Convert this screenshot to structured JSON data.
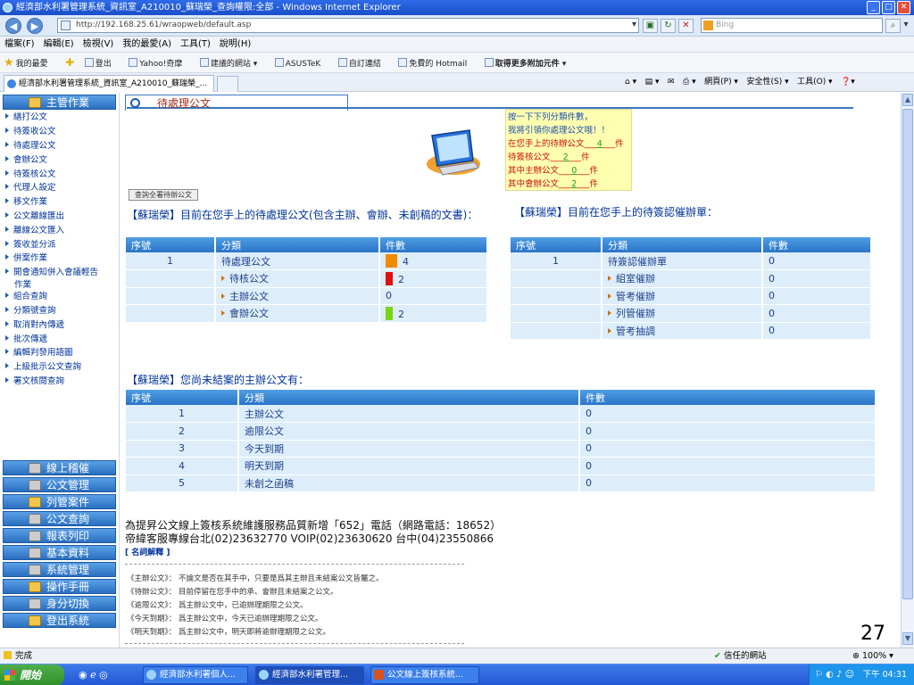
{
  "window": {
    "title": "經濟部水利署管理系統_資訊室_A210010_蘇瑞榮_查詢權限:全部 - Windows Internet Explorer",
    "min": "_",
    "max": "□",
    "close": "✕"
  },
  "address": {
    "url": "http://192.168.25.61/wraopweb/default.asp",
    "search_placeholder": "Bing"
  },
  "menu": [
    "檔案(F)",
    "編輯(E)",
    "檢視(V)",
    "我的最愛(A)",
    "工具(T)",
    "說明(H)"
  ],
  "favorites": {
    "label": "我的最愛",
    "items": [
      "登出",
      "Yahoo!奇摩",
      "建議的網站 ▾",
      "ASUSTeK",
      "自訂連結",
      "免費的 Hotmail",
      "取得更多附加元件 ▾"
    ]
  },
  "tab": {
    "title": "經濟部水利署管理系統_資訊室_A210010_蘇瑞榮_...",
    "cmd": [
      "網頁(P) ▾",
      "安全性(S) ▾",
      "工具(O) ▾"
    ]
  },
  "sidebar": {
    "main_title": "主管作業",
    "items": [
      "繕打公文",
      "待簽收公文",
      "待處理公文",
      "會辦公文",
      "待簽核公文",
      "代理人設定",
      "移文作業",
      "公文離線匯出",
      "離線公文匯入",
      "簽收並分派",
      "併案作業",
      "開會通知併入會議輕告作業",
      "組合查詢",
      "分類號查詢",
      "取消對內傳遞",
      "批次傳遞",
      "編輯判發用語圖",
      "上級批示公文查詢",
      "署文核閱查詢"
    ],
    "sections": [
      "線上稽催",
      "公文管理",
      "列管案件",
      "公文查詢",
      "報表列印",
      "基本資料",
      "系統管理",
      "操作手冊",
      "身分切換",
      "登出系統"
    ]
  },
  "content": {
    "title": "待處理公文",
    "notice": {
      "line1": "按一下下列分類件數，",
      "line2": "我將引領你處理公文哦！！",
      "l3a": "在您手上的待辦公文",
      "l3v": "4",
      "l3b": "件",
      "l4a": "待簽核公文",
      "l4v": "2",
      "l4b": "件",
      "l5a": "其中主辦公文",
      "l5v": "0",
      "l5b": "件",
      "l6a": "其中會辦公文",
      "l6v": "2",
      "l6b": "件"
    },
    "query_all_btn": "查詢全署待辦公文",
    "left_title": "【蘇瑞榮】目前在您手上的待處理公文(包含主辦、會辦、未創稿的文書)：",
    "right_title": "【蘇瑞榮】目前在您手上的待簽認催辦單：",
    "bottom_title": "【蘇瑞榮】您尚未結案的主辦公文有：",
    "headers": [
      "序號",
      "分類",
      "件數"
    ],
    "pending": [
      {
        "no": "1",
        "cat": "待處理公文",
        "count": "4",
        "color": "#f08a00"
      },
      {
        "no": "",
        "cat": "待核公文",
        "count": "2",
        "color": "#e01010"
      },
      {
        "no": "",
        "cat": "主辦公文",
        "count": "0",
        "color": ""
      },
      {
        "no": "",
        "cat": "會辦公文",
        "count": "2",
        "color": "#7cd416"
      }
    ],
    "urge": [
      {
        "no": "1",
        "cat": "待簽認催辦單",
        "count": "0"
      },
      {
        "no": "",
        "cat": "組室催辦",
        "count": "0"
      },
      {
        "no": "",
        "cat": "管考催辦",
        "count": "0"
      },
      {
        "no": "",
        "cat": "列管催辦",
        "count": "0"
      },
      {
        "no": "",
        "cat": "管考抽調",
        "count": "0"
      }
    ],
    "unclosed": [
      {
        "no": "1",
        "cat": "主辦公文",
        "count": "0"
      },
      {
        "no": "2",
        "cat": "逾限公文",
        "count": "0"
      },
      {
        "no": "3",
        "cat": "今天到期",
        "count": "0"
      },
      {
        "no": "4",
        "cat": "明天到期",
        "count": "0"
      },
      {
        "no": "5",
        "cat": "未創之函稿",
        "count": "0"
      }
    ],
    "footer1": "為提昇公文線上簽核系統維護服務品質新增「652」電話（網路電話：18652）",
    "footer2": "帝緯客服專線台北(02)23632770 VOIP(02)23630620 台中(04)23550866",
    "glossary_label": "[ 名詞解釋 ]",
    "definitions": [
      "《主辦公文》：  不論文是否在其手中，只要是爲其主辦且未結案公文皆屬之。",
      "《待辦公文》：  目前停留在您手中的承、會辦且未結案之公文。",
      "《逾限公文》：  爲主辦公文中，已逾辦理期限之公文。",
      "《今天到期》：  爲主辦公文中，今天已逾辦理期限之公文。",
      "《明天到期》：  爲主辦公文中，明天即將逾辦理期限之公文。"
    ],
    "page_number": "27"
  },
  "status": {
    "done": "完成",
    "zone": "信任的網站",
    "zoom": "100%"
  },
  "taskbar": {
    "start": "開始",
    "tasks": [
      "經濟部水利署個人...",
      "經濟部水利署管理...",
      "公文線上簽核系統..."
    ],
    "clock": "下午 04:31"
  }
}
